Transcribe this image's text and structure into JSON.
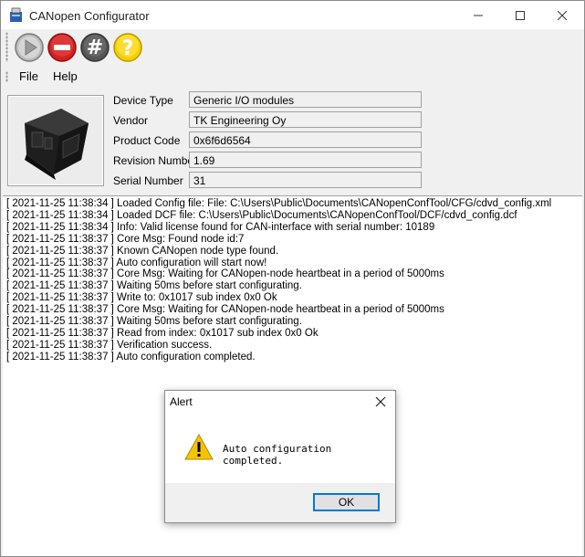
{
  "window": {
    "title": "CANopen Configurator"
  },
  "toolbar": {
    "buttons": [
      {
        "name": "play",
        "color": "#bdbdbd"
      },
      {
        "name": "stop",
        "color": "#d42020"
      },
      {
        "name": "hash",
        "color": "#555555"
      },
      {
        "name": "help",
        "color": "#f5d000"
      }
    ]
  },
  "menu": {
    "items": [
      "File",
      "Help"
    ]
  },
  "device": {
    "fields": [
      {
        "label": "Device Type",
        "value": "Generic I/O modules"
      },
      {
        "label": "Vendor",
        "value": "TK Engineering Oy"
      },
      {
        "label": "Product Code",
        "value": "0x6f6d6564"
      },
      {
        "label": "Revision Number",
        "value": "1.69"
      },
      {
        "label": "Serial Number",
        "value": "31"
      }
    ]
  },
  "log": {
    "lines": [
      "[ 2021-11-25 11:38:34 ] Loaded Config file: File: C:\\Users\\Public\\Documents\\CANopenConfTool/CFG/cdvd_config.xml",
      "[ 2021-11-25 11:38:34 ] Loaded DCF file: C:\\Users\\Public\\Documents\\CANopenConfTool/DCF/cdvd_config.dcf",
      "[ 2021-11-25 11:38:34 ] Info: Valid license found for CAN-interface with serial number: 10189",
      "[ 2021-11-25 11:38:37 ] Core Msg: Found node id:7",
      "[ 2021-11-25 11:38:37 ] Known CANopen node type found.",
      "[ 2021-11-25 11:38:37 ] Auto configuration will start now!",
      "[ 2021-11-25 11:38:37 ] Core Msg: Waiting for CANopen-node heartbeat in a period of 5000ms",
      "[ 2021-11-25 11:38:37 ] Waiting 50ms before start configurating.",
      "[ 2021-11-25 11:38:37 ] Write to: 0x1017 sub index 0x0 Ok",
      "[ 2021-11-25 11:38:37 ] Core Msg: Waiting for CANopen-node heartbeat in a period of 5000ms",
      "[ 2021-11-25 11:38:37 ] Waiting 50ms before start configurating.",
      "[ 2021-11-25 11:38:37 ] Read from index: 0x1017 sub index 0x0  Ok",
      "[ 2021-11-25 11:38:37 ] Verification success.",
      "[ 2021-11-25 11:38:37 ] Auto configuration completed."
    ]
  },
  "dialog": {
    "title": "Alert",
    "message": "Auto configuration completed.",
    "ok_label": "OK",
    "icon": "warning-icon",
    "icon_color": "#f5c400",
    "accent": "#0078d7"
  }
}
